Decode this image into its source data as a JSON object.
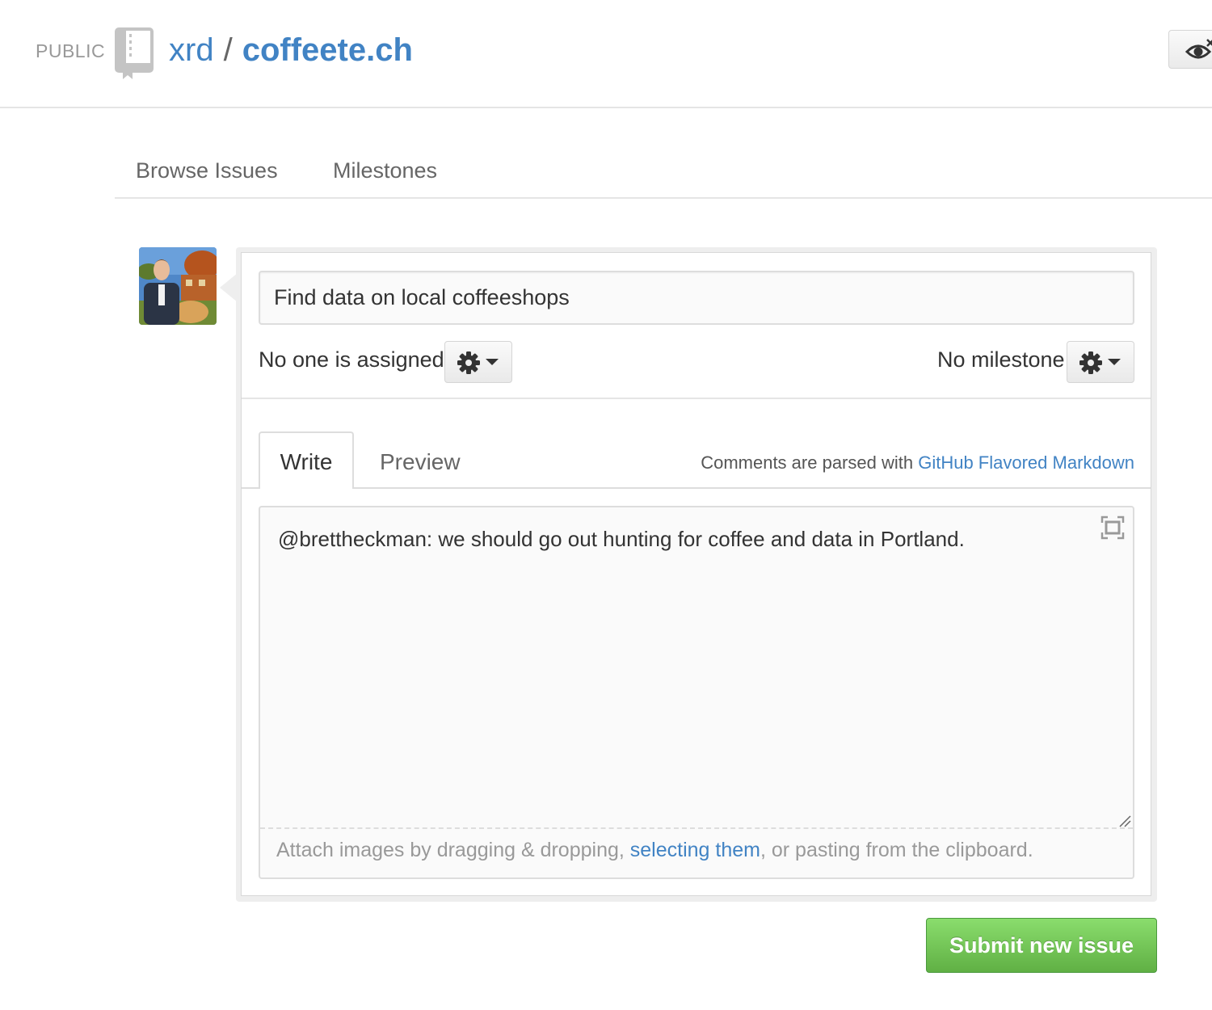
{
  "repo": {
    "visibility": "PUBLIC",
    "owner": "xrd",
    "separator": "/",
    "name": "coffeete.ch"
  },
  "tabs": {
    "browse_issues": "Browse Issues",
    "milestones": "Milestones"
  },
  "issue_form": {
    "title_value": "Find data on local coffeeshops",
    "assignee_label": "No one is assigned",
    "milestone_label": "No milestone",
    "write_tab": "Write",
    "preview_tab": "Preview",
    "markdown_note": "Comments are parsed with",
    "markdown_link": "GitHub Flavored Markdown",
    "body_value": "@brettheckman: we should go out hunting for coffee and data in Portland.",
    "attach_prefix": "Attach images by dragging & dropping,",
    "attach_link": "selecting them",
    "attach_suffix": ", or pasting from the clipboard.",
    "submit_label": "Submit new issue"
  },
  "icons": {
    "repo": "repo-book-icon",
    "watch": "eye-icon",
    "settings": "gear-icon",
    "dropdown": "caret-down-icon",
    "fullscreen": "fullscreen-icon"
  },
  "colors": {
    "link": "#4183c4",
    "submit": "#60b044",
    "border": "#dddddd"
  }
}
